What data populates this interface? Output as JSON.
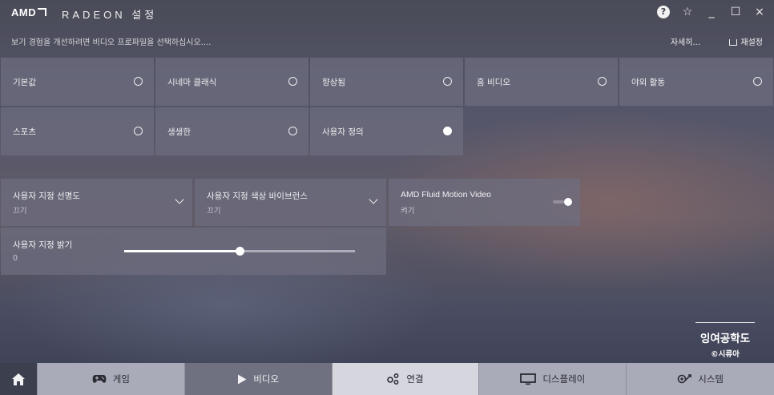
{
  "app": {
    "logo_text": "AMD",
    "brand": "RADEON 설정"
  },
  "title_buttons": {
    "help": "?",
    "favorite": "☆",
    "minimize": "_",
    "maximize": "☐",
    "close": "×"
  },
  "subheader": {
    "hint": "보기 경험을 개선하려면 비디오 프로파일을 선택하십시오....",
    "detail_link": "자세히...",
    "reset_label": "재설정"
  },
  "presets": [
    {
      "label": "기본값",
      "selected": false
    },
    {
      "label": "시네마 클래식",
      "selected": false
    },
    {
      "label": "향상됨",
      "selected": false
    },
    {
      "label": "홈 비디오",
      "selected": false
    },
    {
      "label": "야외 활동",
      "selected": false
    },
    {
      "label": "스포츠",
      "selected": false
    },
    {
      "label": "생생한",
      "selected": false
    },
    {
      "label": "사용자 정의",
      "selected": true
    }
  ],
  "settings": {
    "sharpness": {
      "label": "사용자 지정 선명도",
      "value": "끄기"
    },
    "color_vibrance": {
      "label": "사용자 지정 색상 바이브런스",
      "value": "끄기"
    },
    "fluid_motion": {
      "label": "AMD Fluid Motion Video",
      "value": "켜기",
      "on": true
    },
    "brightness": {
      "label": "사용자 지정 밝기",
      "value": "0",
      "fraction": 0.5
    }
  },
  "watermark": {
    "title": "잉여공학도",
    "subtitle": "©시류아"
  },
  "nav": {
    "home_icon": "home-icon",
    "items": [
      {
        "label": "게임",
        "icon": "gamepad-icon",
        "state": "normal"
      },
      {
        "label": "비디오",
        "icon": "play-icon",
        "state": "active"
      },
      {
        "label": "연결",
        "icon": "connect-icon",
        "state": "light"
      },
      {
        "label": "디스플레이",
        "icon": "monitor-icon",
        "state": "normal"
      },
      {
        "label": "시스템",
        "icon": "system-icon",
        "state": "normal"
      }
    ]
  },
  "colors": {
    "accent": "#ffffff",
    "tile_bg": "#6e6e80",
    "nav_active": "#6f7180"
  }
}
